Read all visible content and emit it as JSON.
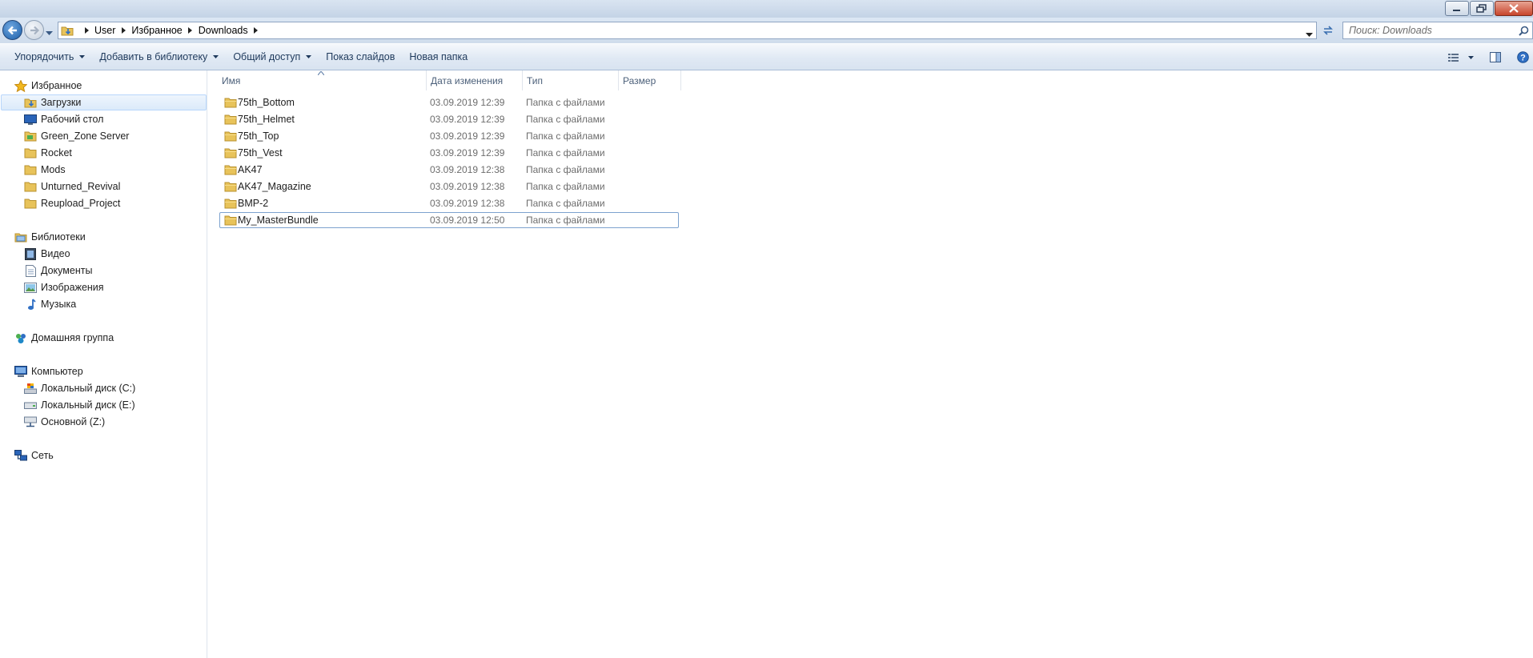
{
  "window": {
    "controls": [
      "minimize-icon",
      "restore-icon",
      "close-icon"
    ]
  },
  "address": {
    "crumbs": [
      "User",
      "Избранное",
      "Downloads"
    ]
  },
  "search": {
    "placeholder": "Поиск: Downloads"
  },
  "toolbar": {
    "organize": "Упорядочить",
    "add_to_library": "Добавить в библиотеку",
    "share": "Общий доступ",
    "slideshow": "Показ слайдов",
    "new_folder": "Новая папка"
  },
  "sidebar": {
    "favorites": {
      "header": "Избранное",
      "items": [
        "Загрузки",
        "Рабочий стол",
        "Green_Zone Server",
        "Rocket",
        "Mods",
        "Unturned_Revival",
        "Reupload_Project"
      ]
    },
    "libraries": {
      "header": "Библиотеки",
      "items": [
        "Видео",
        "Документы",
        "Изображения",
        "Музыка"
      ]
    },
    "homegroup": "Домашняя группа",
    "computer": {
      "header": "Компьютер",
      "items": [
        "Локальный диск (C:)",
        "Локальный диск (E:)",
        "Основной (Z:)"
      ]
    },
    "network": "Сеть"
  },
  "columns": {
    "name": "Имя",
    "date": "Дата изменения",
    "type": "Тип",
    "size": "Размер"
  },
  "files": [
    {
      "name": "75th_Bottom",
      "date": "03.09.2019 12:39",
      "type": "Папка с файлами"
    },
    {
      "name": "75th_Helmet",
      "date": "03.09.2019 12:39",
      "type": "Папка с файлами"
    },
    {
      "name": "75th_Top",
      "date": "03.09.2019 12:39",
      "type": "Папка с файлами"
    },
    {
      "name": "75th_Vest",
      "date": "03.09.2019 12:39",
      "type": "Папка с файлами"
    },
    {
      "name": "AK47",
      "date": "03.09.2019 12:38",
      "type": "Папка с файлами"
    },
    {
      "name": "AK47_Magazine",
      "date": "03.09.2019 12:38",
      "type": "Папка с файлами"
    },
    {
      "name": "BMP-2",
      "date": "03.09.2019 12:38",
      "type": "Папка с файлами"
    },
    {
      "name": "My_MasterBundle",
      "date": "03.09.2019 12:50",
      "type": "Папка с файлами"
    }
  ]
}
